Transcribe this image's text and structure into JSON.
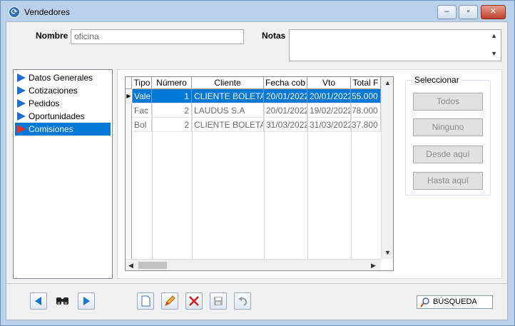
{
  "window": {
    "title": "Vendedores",
    "controls": {
      "minimize": "–",
      "maximize": "▫",
      "close": "✕"
    }
  },
  "form": {
    "nombre_label": "Nombre",
    "nombre_value": "oficina",
    "notas_label": "Notas",
    "notas_value": ""
  },
  "sidebar": {
    "items": [
      {
        "label": "Datos Generales",
        "active": false
      },
      {
        "label": "Cotizaciones",
        "active": false
      },
      {
        "label": "Pedidos",
        "active": false
      },
      {
        "label": "Oportunidades",
        "active": false
      },
      {
        "label": "Comisiones",
        "active": true
      }
    ]
  },
  "grid": {
    "columns": [
      "Tipo",
      "Número",
      "Cliente",
      "Fecha cob",
      "Vto",
      "Total F"
    ],
    "rows": [
      {
        "tipo": "Vale",
        "numero": "1",
        "cliente": "CLIENTE BOLETA",
        "fecha": "20/01/2022",
        "vto": "20/01/2022",
        "total": "55.000",
        "selected": true
      },
      {
        "tipo": "Fac",
        "numero": "2",
        "cliente": "LAUDUS S.A",
        "fecha": "20/01/2022",
        "vto": "19/02/2022",
        "total": "78.000",
        "selected": false
      },
      {
        "tipo": "Bol",
        "numero": "2",
        "cliente": "CLIENTE BOLETA",
        "fecha": "31/03/2022",
        "vto": "31/03/2022",
        "total": "37.800",
        "selected": false
      }
    ]
  },
  "seleccionar": {
    "title": "Seleccionar",
    "buttons": [
      "Todos",
      "Ninguno",
      "Desde aquí",
      "Hasta aquí"
    ]
  },
  "toolbar": {
    "search_label": "BÚSQUEDA"
  },
  "colors": {
    "selection": "#0078d7",
    "nav_arrow": "#1e6fd0",
    "nav_arrow_active": "#e5332a",
    "window_frame": "#b9d1ea"
  }
}
